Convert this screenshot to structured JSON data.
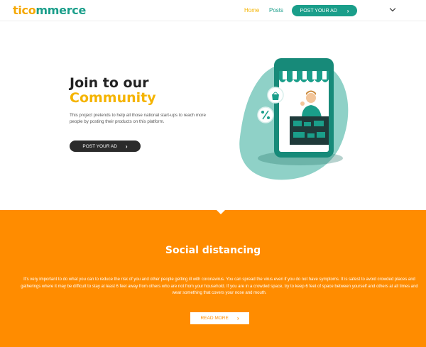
{
  "navbar": {
    "logo_part1": "tico",
    "logo_part2": "mmerce",
    "home_label": "Home",
    "posts_label": "Posts",
    "cta_label": "POST YOUR AD"
  },
  "hero": {
    "title_line1": "Join to our",
    "title_line2": "Community",
    "description": "This project pretends to help all those national start-ups to reach more people by posting their products on this platform.",
    "cta_label": "POST YOUR AD"
  },
  "section": {
    "title": "Social distancing",
    "text": "It's very important to do what you can to reduce the risk of you and other people getting ill with coronavirus. You can spread the virus even if you do not have symptoms. It is safest to avoid crowded places and gatherings where it may be difficult to stay at least 6 feet away from others who are not from your household. If you are in a crowded space, try to keep 6 feet of space between yourself and others at all times and wear something that covers your nose and mouth.",
    "button_label": "READ MORE"
  },
  "colors": {
    "brand_teal": "#1a9e8a",
    "brand_yellow": "#f5b400",
    "section_orange": "#ff8c00",
    "dark_button": "#2b2b2b"
  },
  "icons": {
    "cta_arrow": "chevron-right-icon",
    "dropdown": "chevron-down-icon"
  }
}
